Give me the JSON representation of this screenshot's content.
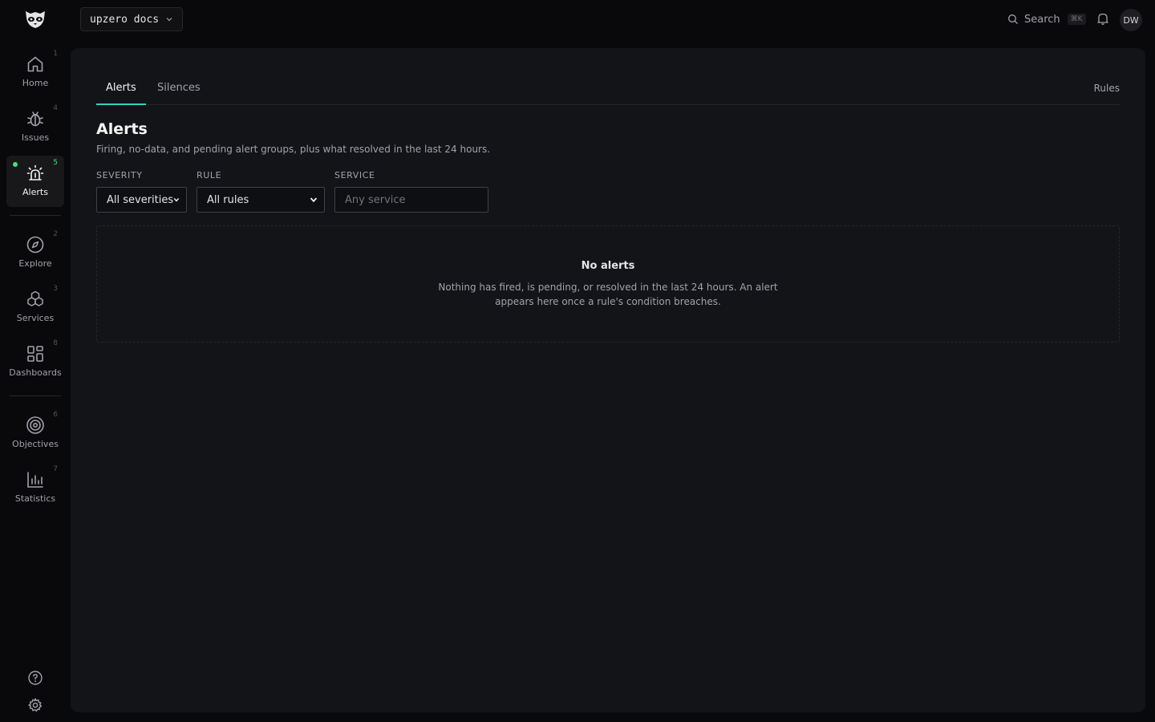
{
  "topbar": {
    "workspace": "upzero docs",
    "search_label": "Search",
    "search_shortcut": "⌘K",
    "avatar_initials": "DW"
  },
  "sidebar": {
    "items": [
      {
        "label": "Home",
        "shortcut": "1",
        "icon": "home-icon"
      },
      {
        "label": "Issues",
        "shortcut": "4",
        "icon": "bug-icon"
      },
      {
        "label": "Alerts",
        "shortcut": "5",
        "icon": "siren-icon",
        "active": true
      },
      {
        "label": "Explore",
        "shortcut": "2",
        "icon": "compass-icon"
      },
      {
        "label": "Services",
        "shortcut": "3",
        "icon": "cubes-icon"
      },
      {
        "label": "Dashboards",
        "shortcut": "8",
        "icon": "grid-icon"
      },
      {
        "label": "Objectives",
        "shortcut": "6",
        "icon": "target-icon"
      },
      {
        "label": "Statistics",
        "shortcut": "7",
        "icon": "bar-chart-icon"
      }
    ],
    "footer": [
      "help-icon",
      "gear-icon"
    ]
  },
  "tabs": {
    "alerts": "Alerts",
    "silences": "Silences",
    "rules": "Rules"
  },
  "page": {
    "title": "Alerts",
    "subtitle": "Firing, no-data, and pending alert groups, plus what resolved in the last 24 hours."
  },
  "filters": {
    "severity_label": "SEVERITY",
    "severity_value": "All severities",
    "rule_label": "RULE",
    "rule_value": "All rules",
    "service_label": "SERVICE",
    "service_placeholder": "Any service"
  },
  "empty_state": {
    "title": "No alerts",
    "message": "Nothing has fired, is pending, or resolved in the last 24 hours. An alert appears here once a rule's condition breaches."
  },
  "colors": {
    "accent": "#2dd4bf",
    "active_dot": "#4ade80",
    "background": "#09090b",
    "panel": "#131418"
  }
}
